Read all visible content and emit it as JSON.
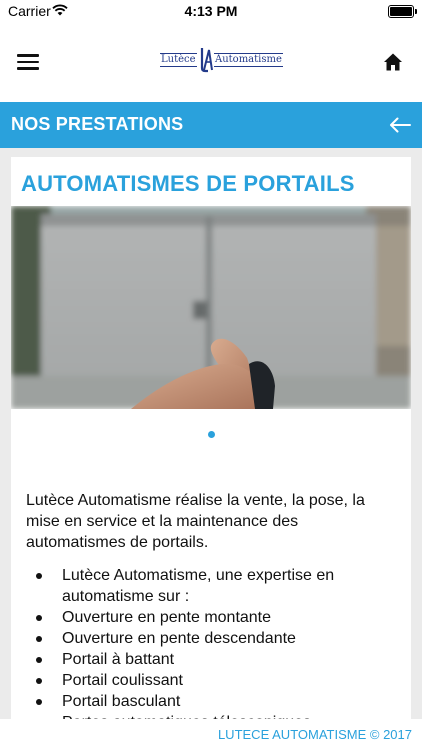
{
  "status_bar": {
    "carrier": "Carrier",
    "time": "4:13 PM"
  },
  "header": {
    "logo_left": "Lutèce",
    "logo_right": "Automatisme"
  },
  "section": {
    "title": "NOS PRESTATIONS"
  },
  "card": {
    "title": "AUTOMATISMES DE PORTAILS",
    "intro": "Lutèce Automatisme réalise la vente, la pose, la mise en service et la maintenance des automatismes de portails.",
    "list": [
      "Lutèce Automatisme, une expertise en automatisme sur :",
      "Ouverture en pente montante",
      "Ouverture en pente descendante",
      "Portail à battant",
      "Portail coulissant",
      "Portail basculant",
      "Portes automatiques télescopiques"
    ]
  },
  "footer": {
    "text": "LUTECE AUTOMATISME © 2017"
  },
  "colors": {
    "accent": "#2aa1dc",
    "background": "#ebebeb"
  },
  "icons": [
    "wifi-icon",
    "battery-icon",
    "menu-icon",
    "home-icon",
    "back-arrow-icon"
  ]
}
